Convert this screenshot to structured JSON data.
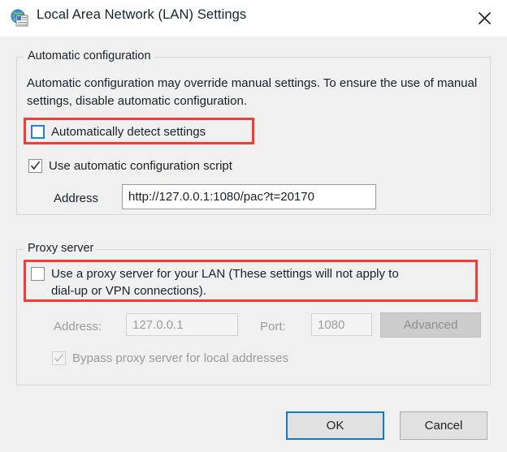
{
  "window": {
    "title": "Local Area Network (LAN) Settings",
    "icon": "lan-settings-icon",
    "close_label": "✕"
  },
  "auto_config": {
    "legend": "Automatic configuration",
    "description": "Automatic configuration may override manual settings.  To ensure the use of manual settings, disable automatic configuration.",
    "detect_settings": {
      "label": "Automatically detect settings",
      "checked": false,
      "focused": true,
      "highlighted": true
    },
    "use_script": {
      "label": "Use automatic configuration script",
      "checked": true
    },
    "address": {
      "label": "Address",
      "value": "http://127.0.0.1:1080/pac?t=20170",
      "placeholder": ""
    }
  },
  "proxy_server": {
    "legend": "Proxy server",
    "use_proxy": {
      "label": "Use a proxy server for your LAN (These settings will not apply to\ndial-up or VPN connections).",
      "checked": false,
      "highlighted": true
    },
    "address": {
      "label": "Address:",
      "value": "127.0.0.1",
      "disabled": true
    },
    "port": {
      "label": "Port:",
      "value": "1080",
      "disabled": true
    },
    "advanced_button": {
      "label": "Advanced",
      "disabled": true
    },
    "bypass": {
      "label": "Bypass proxy server for local addresses",
      "checked": true,
      "disabled": true
    }
  },
  "footer": {
    "ok_label": "OK",
    "cancel_label": "Cancel"
  },
  "colors": {
    "titlebar_bg": "#ffffff",
    "dialog_bg": "#f0f0f0",
    "annotation_red": "#f83a36",
    "focus_blue": "#0d7bd4",
    "disabled_text": "#9b9b9b"
  }
}
